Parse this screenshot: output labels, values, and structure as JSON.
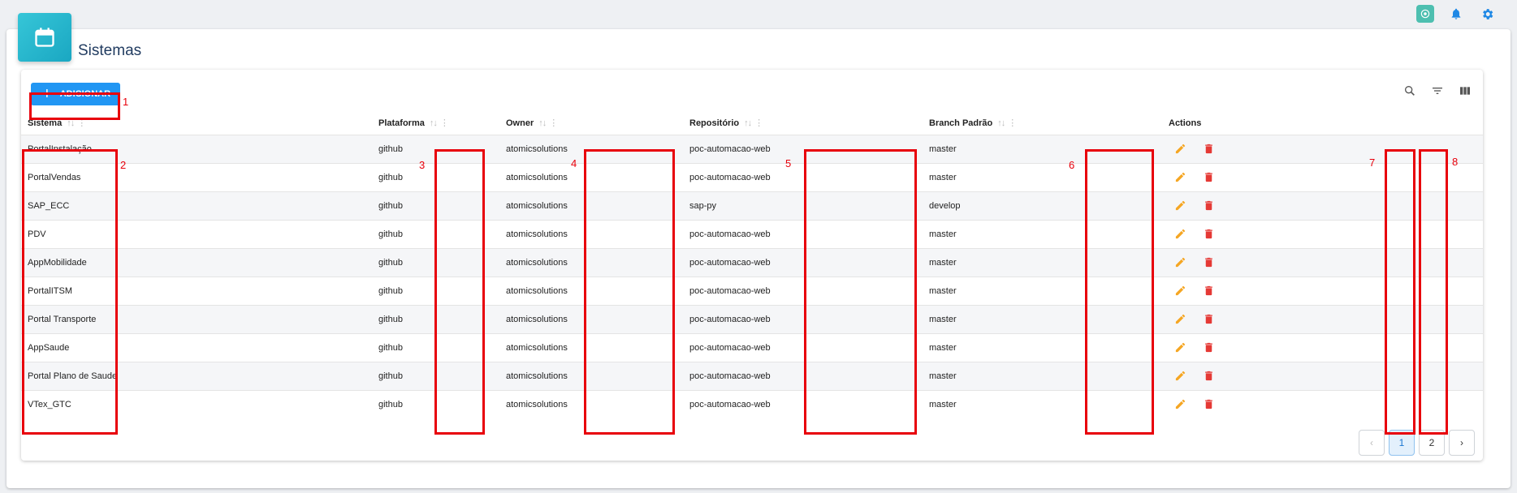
{
  "header": {
    "title": "Sistemas",
    "header_icon": "calendar-icon"
  },
  "top_icons": [
    "ai-assistant-icon",
    "bell-icon",
    "gear-icon"
  ],
  "toolbar": {
    "add_label": "ADICIONAR",
    "add_icon": "plus-icon",
    "tool_icons": [
      "search-icon",
      "filter-icon",
      "columns-icon"
    ]
  },
  "table": {
    "columns": [
      "Sistema",
      "Plataforma",
      "Owner",
      "Repositório",
      "Branch Padrão",
      "Actions"
    ],
    "rows": [
      [
        "PortalInstalação",
        "github",
        "atomicsolutions",
        "poc-automacao-web",
        "master"
      ],
      [
        "PortalVendas",
        "github",
        "atomicsolutions",
        "poc-automacao-web",
        "master"
      ],
      [
        "SAP_ECC",
        "github",
        "atomicsolutions",
        "sap-py",
        "develop"
      ],
      [
        "PDV",
        "github",
        "atomicsolutions",
        "poc-automacao-web",
        "master"
      ],
      [
        "AppMobilidade",
        "github",
        "atomicsolutions",
        "poc-automacao-web",
        "master"
      ],
      [
        "PortalITSM",
        "github",
        "atomicsolutions",
        "poc-automacao-web",
        "master"
      ],
      [
        "Portal Transporte",
        "github",
        "atomicsolutions",
        "poc-automacao-web",
        "master"
      ],
      [
        "AppSaude",
        "github",
        "atomicsolutions",
        "poc-automacao-web",
        "master"
      ],
      [
        "Portal Plano de Saude",
        "github",
        "atomicsolutions",
        "poc-automacao-web",
        "master"
      ],
      [
        "VTex_GTC",
        "github",
        "atomicsolutions",
        "poc-automacao-web",
        "master"
      ]
    ]
  },
  "pagination": {
    "prev": "‹",
    "pages": [
      "1",
      "2"
    ],
    "current": "1",
    "next": "›"
  },
  "annotations": [
    "1",
    "2",
    "3",
    "4",
    "5",
    "6",
    "7",
    "8"
  ],
  "colors": {
    "accent": "#2196f3",
    "edit": "#f5a623",
    "delete": "#e53935",
    "annotation": "#e8000b",
    "title": "#1f3a5f"
  }
}
